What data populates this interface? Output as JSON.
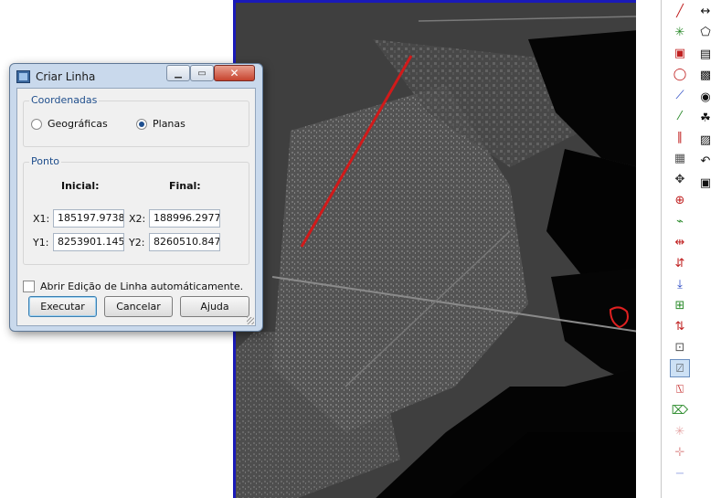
{
  "dialog": {
    "title": "Criar Linha",
    "min_glyph": "▁",
    "max_glyph": "▭",
    "close_glyph": "✕",
    "coord_group": {
      "title": "Coordenadas",
      "options": [
        "Geográficas",
        "Planas"
      ],
      "selected": "Planas"
    },
    "ponto_group": {
      "title": "Ponto",
      "initial_header": "Inicial:",
      "final_header": "Final:",
      "x1_label": "X1:",
      "x1_value": "185197.9738",
      "y1_label": "Y1:",
      "y1_value": "8253901.1451",
      "x2_label": "X2:",
      "x2_value": "188996.2977",
      "y2_label": "Y2:",
      "y2_value": "8260510.8470"
    },
    "auto_edit_label": "Abrir Edição de Linha automáticamente.",
    "auto_edit_checked": false,
    "buttons": {
      "execute": "Executar",
      "cancel": "Cancelar",
      "help": "Ajuda"
    }
  },
  "map": {
    "line_color": "#d11a1a",
    "frame_color": "#1a1ab8"
  },
  "toolbar_a": [
    {
      "name": "draw-line-icon",
      "glyph": "╱"
    },
    {
      "name": "vertex-edit-icon",
      "glyph": "✳"
    },
    {
      "name": "rectangle-edit-icon",
      "glyph": "▣"
    },
    {
      "name": "circle-edit-icon",
      "glyph": "◯"
    },
    {
      "name": "polyline-edit-icon",
      "glyph": "⟋"
    },
    {
      "name": "segment-icon",
      "glyph": "⁄"
    },
    {
      "name": "parallel-lines-icon",
      "glyph": "∥"
    },
    {
      "name": "grid-points-icon",
      "glyph": "▦"
    },
    {
      "name": "move-icon",
      "glyph": "✥"
    },
    {
      "name": "move-vertex-icon",
      "glyph": "⊕"
    },
    {
      "name": "reshape-icon",
      "glyph": "⌁"
    },
    {
      "name": "split-icon",
      "glyph": "⇹"
    },
    {
      "name": "merge-icon",
      "glyph": "⇵"
    },
    {
      "name": "snap-down-icon",
      "glyph": "⤓"
    },
    {
      "name": "grid-add-icon",
      "glyph": "⊞"
    },
    {
      "name": "swap-direction-icon",
      "glyph": "⇅"
    },
    {
      "name": "transform-icon",
      "glyph": "⊡"
    },
    {
      "name": "create-line-icon",
      "glyph": "⍁"
    },
    {
      "name": "edit-polygon-icon",
      "glyph": "⍂"
    },
    {
      "name": "remove-node-icon",
      "glyph": "⌦"
    },
    {
      "name": "points-icon",
      "glyph": "✳"
    },
    {
      "name": "pan-icon",
      "glyph": "✛"
    },
    {
      "name": "minus-icon",
      "glyph": "−"
    }
  ],
  "toolbar_b": [
    {
      "name": "measure-icon",
      "glyph": "↔"
    },
    {
      "name": "polygon-icon",
      "glyph": "⬠"
    },
    {
      "name": "layers-icon",
      "glyph": "▤"
    },
    {
      "name": "map-color-icon",
      "glyph": "▩"
    },
    {
      "name": "palette-icon",
      "glyph": "◉"
    },
    {
      "name": "brazil-map-icon",
      "glyph": "☘"
    },
    {
      "name": "hatch-icon",
      "glyph": "▨"
    },
    {
      "name": "undo-icon",
      "glyph": "↶"
    },
    {
      "name": "save-icon",
      "glyph": "▣"
    }
  ]
}
